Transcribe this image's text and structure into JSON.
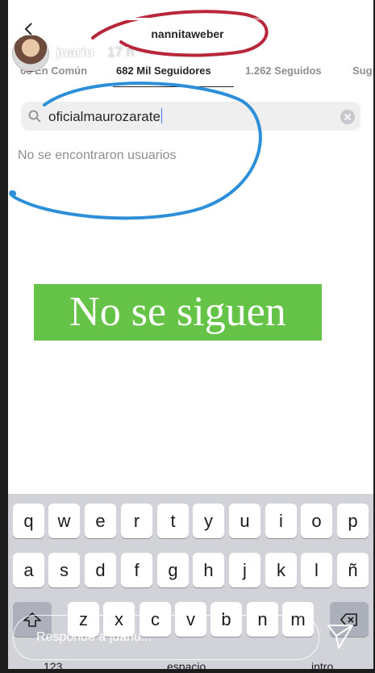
{
  "story": {
    "username": "juariu",
    "time": "17 h",
    "progress": [
      1,
      1,
      1,
      0.55,
      0,
      0,
      0
    ],
    "reply_placeholder": "Responde a juariu..."
  },
  "profile": {
    "name": "nannitaweber",
    "tabs": [
      {
        "label": "66 En Común"
      },
      {
        "label": "682 Mil Seguidores"
      },
      {
        "label": "1.262 Seguidos"
      },
      {
        "label": "Sug"
      }
    ]
  },
  "search": {
    "value": "oficialmaurozarate",
    "no_results": "No se encontraron usuarios"
  },
  "caption": {
    "text": "No se siguen",
    "color": "#65c447"
  },
  "keyboard": {
    "row1": [
      "q",
      "w",
      "e",
      "r",
      "t",
      "y",
      "u",
      "i",
      "o",
      "p"
    ],
    "row2": [
      "a",
      "s",
      "d",
      "f",
      "g",
      "h",
      "j",
      "k",
      "l",
      "ñ"
    ],
    "row3": [
      "z",
      "x",
      "c",
      "v",
      "b",
      "n",
      "m"
    ],
    "bottom": {
      "numbers": "123",
      "space": "espacio",
      "return": "intro"
    }
  },
  "colors": {
    "annotation_red": "#b8263a",
    "annotation_blue": "#2d8fd8"
  }
}
